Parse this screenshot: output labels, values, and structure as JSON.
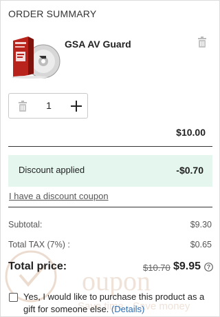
{
  "summary": {
    "heading": "ORDER SUMMARY"
  },
  "product": {
    "name": "GSA AV Guard",
    "quantity": "1",
    "line_total": "$10.00"
  },
  "discount": {
    "label": "Discount applied",
    "amount": "-$0.70",
    "coupon_link": "I have a discount coupon"
  },
  "totals": {
    "subtotal_label": "Subtotal:",
    "subtotal_value": "$9.30",
    "tax_label": "Total TAX (7%) :",
    "tax_value": "$0.65",
    "total_label": "Total price:",
    "old_price": "$10.70",
    "new_price": "$9.95"
  },
  "gift": {
    "text": "Yes, I would like to purchase this product as a gift for someone else.",
    "details_link": "(Details)",
    "checked": false
  },
  "watermark": {
    "word": "oupon",
    "tagline": "Save time · Save money"
  },
  "colors": {
    "discount_bg": "#e4f6ee",
    "link_blue": "#2f6fb3"
  },
  "icons": {
    "remove_top": "trash-icon",
    "stepper_remove": "trash-icon",
    "stepper_add": "plus-icon",
    "help": "question-circle-icon"
  }
}
